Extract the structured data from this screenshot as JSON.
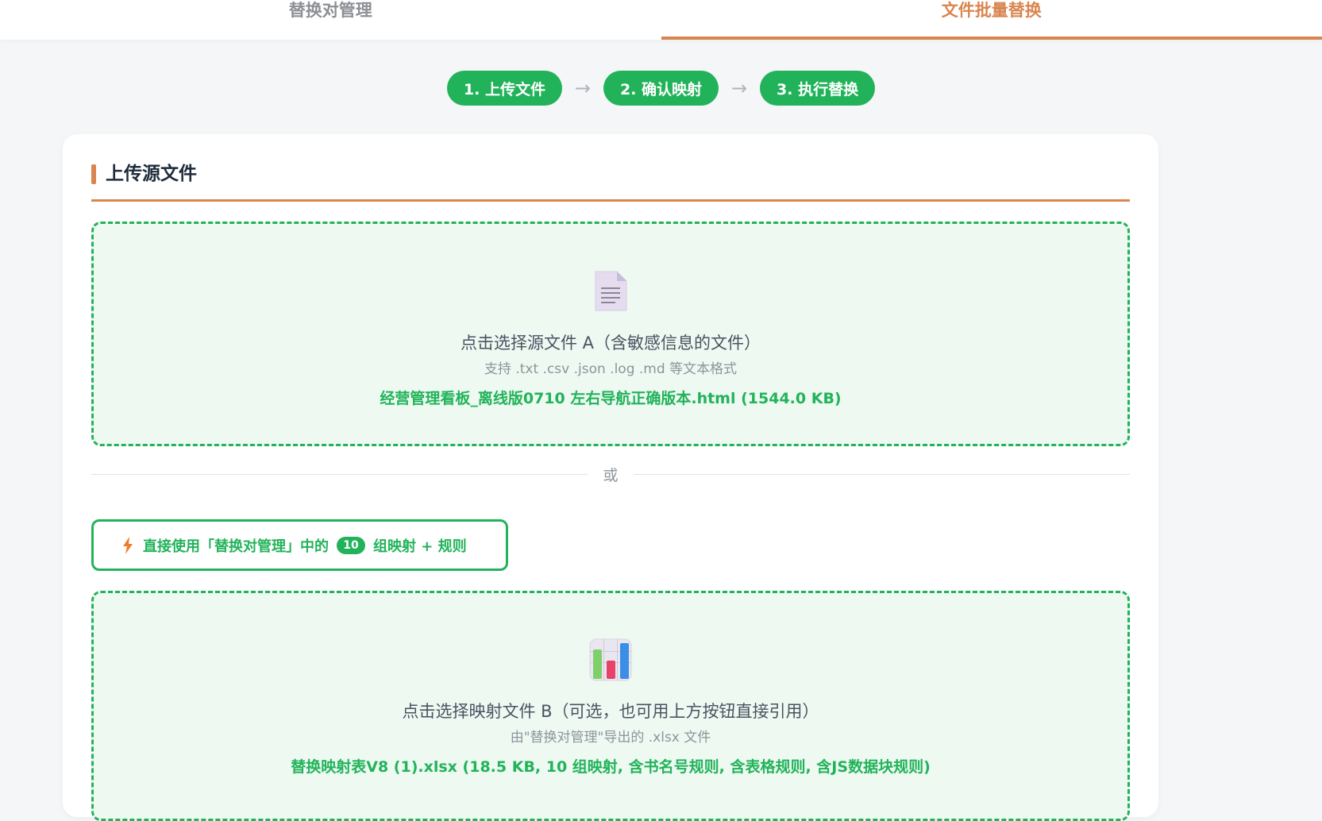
{
  "tabs": [
    {
      "label": "替换对管理",
      "active": false
    },
    {
      "label": "文件批量替换",
      "active": true
    }
  ],
  "steps": [
    {
      "label": "1. 上传文件"
    },
    {
      "label": "2. 确认映射"
    },
    {
      "label": "3. 执行替换"
    }
  ],
  "step_arrow": "→",
  "section": {
    "title": "上传源文件"
  },
  "file_a": {
    "icon": "document-icon",
    "main": "点击选择源文件 A（含敏感信息的文件）",
    "sub": "支持 .txt .csv .json .log .md 等文本格式",
    "selected": "经营管理看板_离线版0710 左右导航正确版本.html (1544.0 KB)"
  },
  "divider_text": "或",
  "use_existing": {
    "prefix": "直接使用「替换对管理」中的",
    "count": "10",
    "suffix": "组映射 + 规则"
  },
  "file_b": {
    "icon": "bar-chart-icon",
    "main": "点击选择映射文件 B（可选，也可用上方按钮直接引用）",
    "sub": "由\"替换对管理\"导出的 .xlsx 文件",
    "selected": "替换映射表V8 (1).xlsx (18.5 KB, 10 组映射, 含书名号规则, 含表格规则, 含JS数据块规则)"
  },
  "colors": {
    "accent_orange": "#d9854f",
    "primary_green": "#22b35a",
    "drop_bg": "#eef9f2"
  }
}
